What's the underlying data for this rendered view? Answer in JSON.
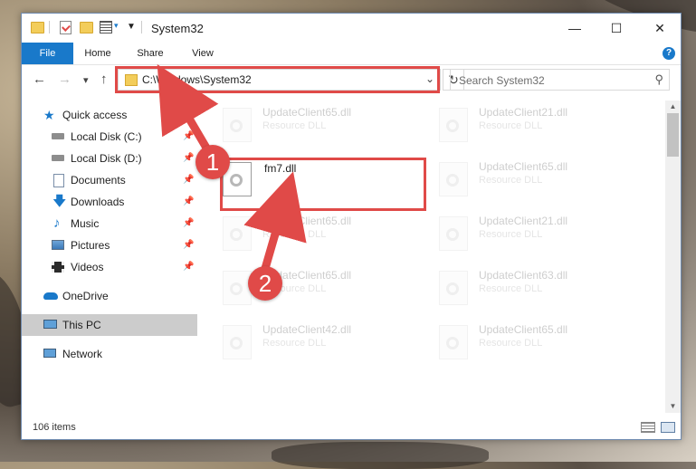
{
  "window": {
    "title": "System32",
    "controls": {
      "minimize": "—",
      "maximize": "☐",
      "close": "✕"
    }
  },
  "ribbon": {
    "tabs": [
      "File",
      "Home",
      "Share",
      "View"
    ],
    "help": "?"
  },
  "navbar": {
    "back": "←",
    "forward": "→",
    "recent": "▾",
    "up": "↑",
    "address": "C:\\Windows\\System32",
    "address_dropdown": "⌄",
    "refresh": "↻",
    "search_placeholder": "Search System32",
    "search_icon": "⚲"
  },
  "sidebar": {
    "items": [
      {
        "label": "Quick access",
        "icon": "star-icon",
        "pinned": false
      },
      {
        "label": "Local Disk (C:)",
        "icon": "drive-icon",
        "pinned": true
      },
      {
        "label": "Local Disk (D:)",
        "icon": "drive-icon",
        "pinned": true
      },
      {
        "label": "Documents",
        "icon": "documents-icon",
        "pinned": true
      },
      {
        "label": "Downloads",
        "icon": "downloads-icon",
        "pinned": true
      },
      {
        "label": "Music",
        "icon": "music-icon",
        "pinned": true
      },
      {
        "label": "Pictures",
        "icon": "pictures-icon",
        "pinned": true
      },
      {
        "label": "Videos",
        "icon": "videos-icon",
        "pinned": true
      },
      {
        "label": "OneDrive",
        "icon": "cloud-icon",
        "pinned": false
      },
      {
        "label": "This PC",
        "icon": "computer-icon",
        "pinned": false,
        "selected": true
      },
      {
        "label": "Network",
        "icon": "network-icon",
        "pinned": false
      }
    ],
    "pin_glyph": "📌"
  },
  "files": {
    "highlighted": {
      "name": "fm7.dll"
    },
    "ghost": [
      {
        "name": "UpdateClient65.dll",
        "type": "Resource DLL"
      },
      {
        "name": "UpdateClient21.dll",
        "type": "Resource DLL"
      },
      {
        "name": "UpdateClient65.dll",
        "type": "Resource DLL"
      },
      {
        "name": "UpdateClient65.dll",
        "type": "Resource DLL"
      },
      {
        "name": "UpdateClient21.dll",
        "type": "Resource DLL"
      },
      {
        "name": "UpdateClient65.dll",
        "type": "Resource DLL"
      },
      {
        "name": "UpdateClient63.dll",
        "type": "Resource DLL"
      },
      {
        "name": "UpdateClient42.dll",
        "type": "Resource DLL"
      },
      {
        "name": "UpdateClient65.dll",
        "type": "Resource DLL"
      }
    ]
  },
  "status": {
    "count": "106 items"
  },
  "annotations": {
    "step1": "1",
    "step2": "2",
    "color": "#e04a48"
  },
  "colors": {
    "accent": "#1979ca",
    "folder": "#f3cd5a",
    "selection": "#cccccc"
  }
}
